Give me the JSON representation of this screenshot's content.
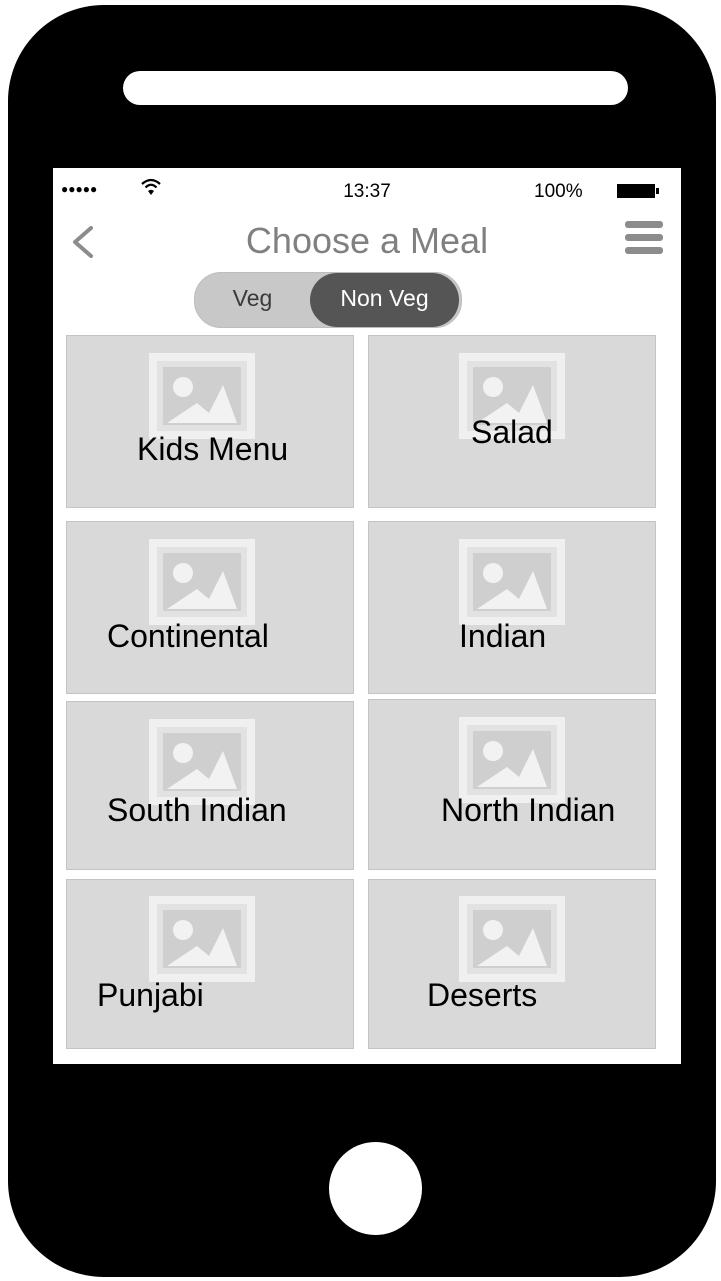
{
  "status": {
    "signal": "●●●●●",
    "time": "13:37",
    "battery": "100%"
  },
  "header": {
    "title": "Choose a Meal"
  },
  "toggle": {
    "veg": "Veg",
    "nonveg": "Non Veg",
    "selected": "Non Veg"
  },
  "meals": [
    {
      "label": "Kids Menu"
    },
    {
      "label": "Salad"
    },
    {
      "label": "Continental"
    },
    {
      "label": "Indian"
    },
    {
      "label": "South Indian"
    },
    {
      "label": "North Indian"
    },
    {
      "label": "Punjabi"
    },
    {
      "label": "Deserts"
    }
  ]
}
